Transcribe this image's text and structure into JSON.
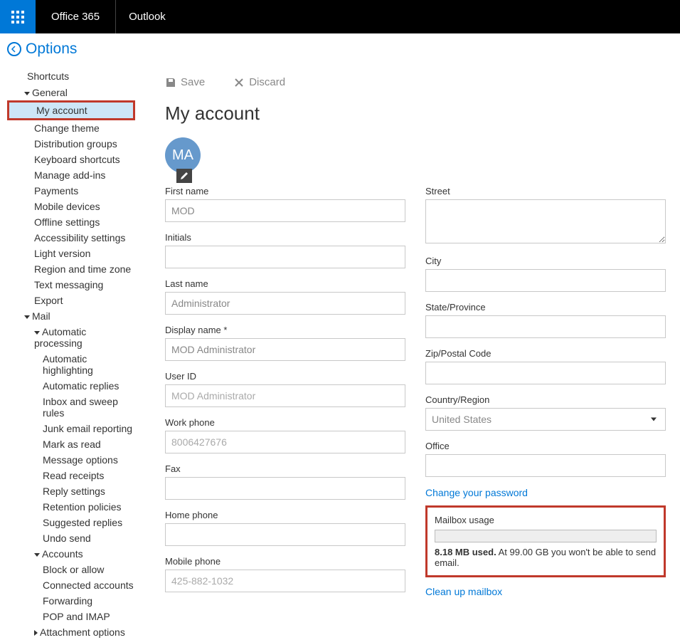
{
  "topbar": {
    "brand": "Office 365",
    "app": "Outlook"
  },
  "options_title": "Options",
  "sidebar": {
    "shortcuts": "Shortcuts",
    "general": "General",
    "general_items": [
      "My account",
      "Change theme",
      "Distribution groups",
      "Keyboard shortcuts",
      "Manage add-ins",
      "Payments",
      "Mobile devices",
      "Offline settings",
      "Accessibility settings",
      "Light version",
      "Region and time zone",
      "Text messaging",
      "Export"
    ],
    "mail": "Mail",
    "auto_processing": "Automatic processing",
    "auto_items": [
      "Automatic highlighting",
      "Automatic replies",
      "Inbox and sweep rules",
      "Junk email reporting",
      "Mark as read",
      "Message options",
      "Read receipts",
      "Reply settings",
      "Retention policies",
      "Suggested replies",
      "Undo send"
    ],
    "accounts": "Accounts",
    "accounts_items": [
      "Block or allow",
      "Connected accounts",
      "Forwarding",
      "POP and IMAP"
    ],
    "attachment": "Attachment options"
  },
  "toolbar": {
    "save": "Save",
    "discard": "Discard"
  },
  "page": {
    "title": "My account",
    "avatar_initials": "MA",
    "labels": {
      "first_name": "First name",
      "initials": "Initials",
      "last_name": "Last name",
      "display_name": "Display name *",
      "user_id": "User ID",
      "work_phone": "Work phone",
      "fax": "Fax",
      "home_phone": "Home phone",
      "mobile_phone": "Mobile phone",
      "street": "Street",
      "city": "City",
      "state": "State/Province",
      "zip": "Zip/Postal Code",
      "country": "Country/Region",
      "office": "Office"
    },
    "values": {
      "first_name": "MOD",
      "initials": "",
      "last_name": "Administrator",
      "display_name": "MOD Administrator",
      "user_id": "MOD Administrator",
      "work_phone": "8006427676",
      "fax": "",
      "home_phone": "",
      "mobile_phone": "425-882-1032",
      "street": "",
      "city": "",
      "state": "",
      "zip": "",
      "country": "United States",
      "office": ""
    },
    "links": {
      "change_password": "Change your password",
      "cleanup": "Clean up mailbox"
    },
    "usage": {
      "label": "Mailbox usage",
      "used_bold": "8.18 MB used.",
      "rest": "  At 99.00 GB you won't be able to send email."
    }
  }
}
